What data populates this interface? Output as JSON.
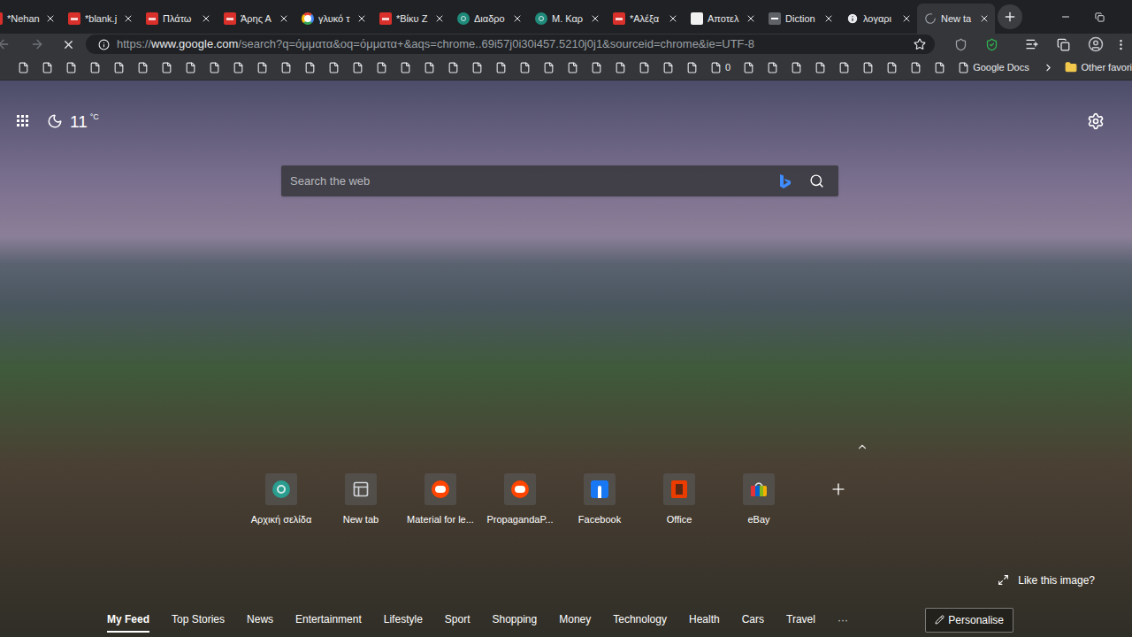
{
  "browser": {
    "tabs": [
      {
        "label": "*Nehan",
        "kind": "pdf",
        "selected": false
      },
      {
        "label": "*blank.j",
        "kind": "pdf",
        "selected": false
      },
      {
        "label": "Πλάτω",
        "kind": "pdf",
        "selected": false
      },
      {
        "label": "Άρης Α",
        "kind": "pdf",
        "selected": false
      },
      {
        "label": "γλυκό τ",
        "kind": "google",
        "selected": false
      },
      {
        "label": "*Βίκυ Ζ",
        "kind": "pdf",
        "selected": false
      },
      {
        "label": "Διαδρο",
        "kind": "edge",
        "selected": false
      },
      {
        "label": "Μ. Καρ",
        "kind": "edge",
        "selected": false
      },
      {
        "label": "*Αλέξα",
        "kind": "pdf",
        "selected": false
      },
      {
        "label": "Αποτελ",
        "kind": "wiki",
        "selected": false
      },
      {
        "label": "Diction",
        "kind": "dictionary",
        "selected": false
      },
      {
        "label": "λογαρι",
        "kind": "info",
        "selected": false
      },
      {
        "label": "New ta",
        "kind": "loading",
        "selected": true
      }
    ],
    "navigation": {
      "back_enabled": false,
      "forward_enabled": false
    },
    "address": {
      "scheme": "https://",
      "host": "www.google.com",
      "path": "/search?q=όμματα&oq=όμματα+&aqs=chrome..69i57j0i30i457.5210j0j1&sourceid=chrome&ie=UTF-8"
    },
    "bookmarks": [
      {
        "label": ""
      },
      {
        "label": ""
      },
      {
        "label": ""
      },
      {
        "label": ""
      },
      {
        "label": ""
      },
      {
        "label": ""
      },
      {
        "label": ""
      },
      {
        "label": ""
      },
      {
        "label": ""
      },
      {
        "label": ""
      },
      {
        "label": ""
      },
      {
        "label": ""
      },
      {
        "label": ""
      },
      {
        "label": ""
      },
      {
        "label": ""
      },
      {
        "label": ""
      },
      {
        "label": ""
      },
      {
        "label": ""
      },
      {
        "label": ""
      },
      {
        "label": ""
      },
      {
        "label": ""
      },
      {
        "label": ""
      },
      {
        "label": ""
      },
      {
        "label": ""
      },
      {
        "label": ""
      },
      {
        "label": ""
      },
      {
        "label": ""
      },
      {
        "label": ""
      },
      {
        "label": ""
      },
      {
        "label": "0"
      },
      {
        "label": ""
      },
      {
        "label": ""
      },
      {
        "label": ""
      },
      {
        "label": ""
      },
      {
        "label": ""
      },
      {
        "label": ""
      },
      {
        "label": ""
      },
      {
        "label": ""
      },
      {
        "label": ""
      },
      {
        "label": "Google Docs"
      }
    ],
    "other_favourites": "Other favori"
  },
  "page": {
    "weather": {
      "temperature": "11",
      "unit": "°C"
    },
    "search": {
      "placeholder": "Search the web"
    },
    "tiles": [
      {
        "label": "Αρχική σελίδα",
        "kind": "edge"
      },
      {
        "label": "New tab",
        "kind": "newtab"
      },
      {
        "label": "Material for le...",
        "kind": "reddit"
      },
      {
        "label": "PropagandaP...",
        "kind": "reddit"
      },
      {
        "label": "Facebook",
        "kind": "facebook"
      },
      {
        "label": "Office",
        "kind": "office"
      },
      {
        "label": "eBay",
        "kind": "ebay"
      }
    ],
    "like_image": "Like this image?",
    "feed_tabs": [
      {
        "label": "My Feed",
        "selected": true
      },
      {
        "label": "Top Stories",
        "selected": false
      },
      {
        "label": "News",
        "selected": false
      },
      {
        "label": "Entertainment",
        "selected": false
      },
      {
        "label": "Lifestyle",
        "selected": false
      },
      {
        "label": "Sport",
        "selected": false
      },
      {
        "label": "Shopping",
        "selected": false
      },
      {
        "label": "Money",
        "selected": false
      },
      {
        "label": "Technology",
        "selected": false
      },
      {
        "label": "Health",
        "selected": false
      },
      {
        "label": "Cars",
        "selected": false
      },
      {
        "label": "Travel",
        "selected": false
      }
    ],
    "more": "···",
    "personalise": "Personalise"
  }
}
